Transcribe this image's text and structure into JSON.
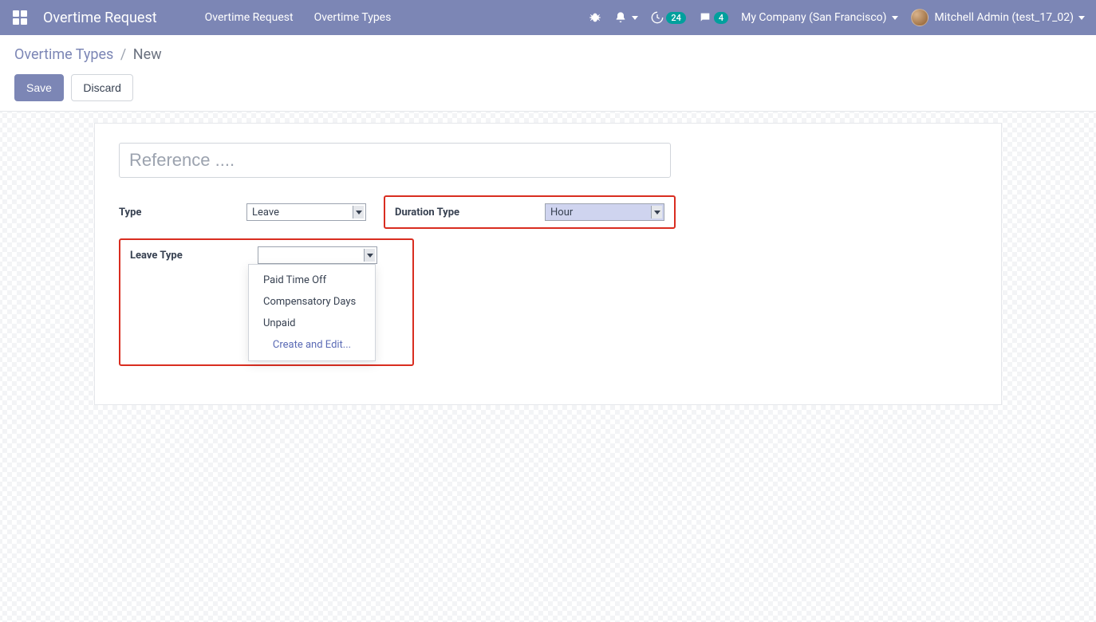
{
  "navbar": {
    "app_title": "Overtime Request",
    "menu": {
      "overtime_request": "Overtime Request",
      "overtime_types": "Overtime Types"
    },
    "activities_badge": "24",
    "discuss_badge": "4",
    "company": "My Company (San Francisco)",
    "user": "Mitchell Admin (test_17_02)"
  },
  "breadcrumb": {
    "parent": "Overtime Types",
    "current": "New"
  },
  "actions": {
    "save": "Save",
    "discard": "Discard"
  },
  "form": {
    "title_placeholder": "Reference ....",
    "labels": {
      "type": "Type",
      "duration_type": "Duration Type",
      "leave_type": "Leave Type"
    },
    "values": {
      "type": "Leave",
      "duration_type": "Hour",
      "leave_type": ""
    },
    "leave_type_options": {
      "pto": "Paid Time Off",
      "comp": "Compensatory Days",
      "unpaid": "Unpaid",
      "create": "Create and Edit..."
    }
  }
}
